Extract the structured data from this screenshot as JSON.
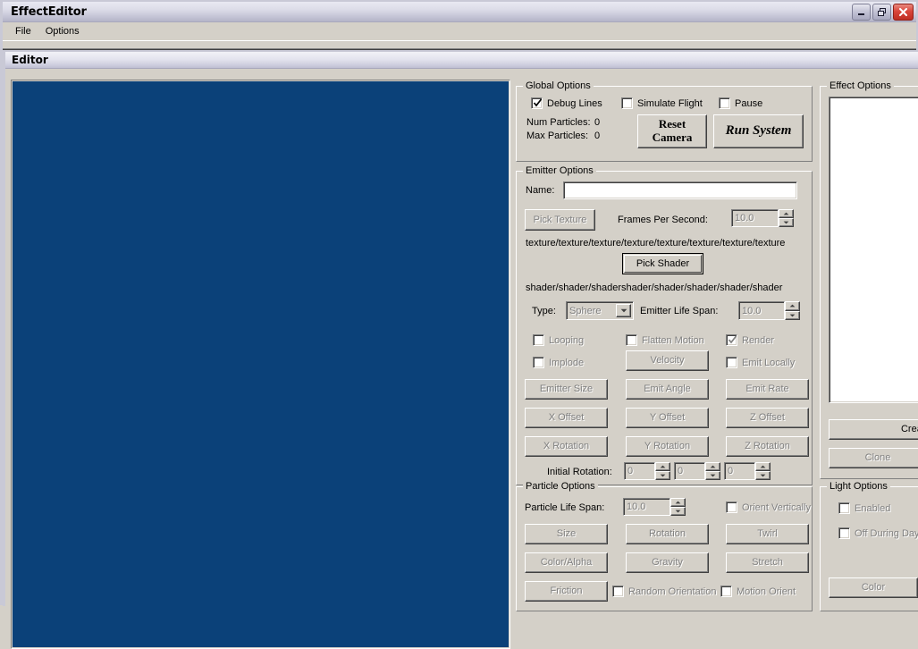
{
  "window": {
    "title": "EffectEditor",
    "buttons": {
      "minimize": "minimize-button",
      "maximize": "restore-button",
      "close": "close-button"
    }
  },
  "menubar": {
    "items": [
      {
        "label": "File"
      },
      {
        "label": "Options"
      }
    ]
  },
  "child_window": {
    "title": "Editor"
  },
  "viewport": {
    "background_color": "#0b4179"
  },
  "global_options": {
    "title": "Global Options",
    "checkboxes": [
      {
        "label": "Debug Lines",
        "checked": true,
        "enabled": true
      },
      {
        "label": "Simulate Flight",
        "checked": false,
        "enabled": true
      },
      {
        "label": "Pause",
        "checked": false,
        "enabled": true
      }
    ],
    "num_particles_label": "Num Particles:",
    "num_particles_value": "0",
    "max_particles_label": "Max Particles:",
    "max_particles_value": "0",
    "reset_camera_label": "Reset\nCamera",
    "reset_camera_line1": "Reset",
    "reset_camera_line2": "Camera",
    "run_system_label": "Run System"
  },
  "emitter_options": {
    "title": "Emitter Options",
    "name_label": "Name:",
    "name_value": "",
    "name_placeholder": "",
    "pick_texture_label": "Pick Texture",
    "frames_per_second_label": "Frames Per Second:",
    "frames_per_second_value": "10.0",
    "texture_path": "texture/texture/texture/texture/texture/texture/texture/texture",
    "pick_shader_label": "Pick Shader",
    "shader_path": "shader/shader/shadershader/shader/shader/shader/shader",
    "type_label": "Type:",
    "type_value": "Sphere",
    "emitter_life_span_label": "Emitter Life Span:",
    "emitter_life_span_value": "10.0",
    "checkboxes": [
      {
        "label": "Looping",
        "checked": false,
        "enabled": false
      },
      {
        "label": "Flatten Motion",
        "checked": false,
        "enabled": false
      },
      {
        "label": "Render",
        "checked": true,
        "enabled": false
      },
      {
        "label": "Implode",
        "checked": false,
        "enabled": false
      },
      {
        "label": "Emit Locally",
        "checked": false,
        "enabled": false
      }
    ],
    "buttons": [
      {
        "label": "Velocity",
        "enabled": false
      },
      {
        "label": "Emitter Size",
        "enabled": false
      },
      {
        "label": "Emit Angle",
        "enabled": false
      },
      {
        "label": "Emit Rate",
        "enabled": false
      },
      {
        "label": "X Offset",
        "enabled": false
      },
      {
        "label": "Y Offset",
        "enabled": false
      },
      {
        "label": "Z Offset",
        "enabled": false
      },
      {
        "label": "X Rotation",
        "enabled": false
      },
      {
        "label": "Y Rotation",
        "enabled": false
      },
      {
        "label": "Z Rotation",
        "enabled": false
      }
    ],
    "initial_rotation_label": "Initial Rotation:",
    "initial_rotation_values": [
      "0",
      "0",
      "0"
    ]
  },
  "particle_options": {
    "title": "Particle Options",
    "particle_life_span_label": "Particle Life Span:",
    "particle_life_span_value": "10.0",
    "orient_vertically_label": "Orient Vertically",
    "random_orientation_label": "Random Orientation",
    "motion_orient_label": "Motion Orient",
    "buttons": [
      {
        "label": "Size",
        "enabled": false
      },
      {
        "label": "Rotation",
        "enabled": false
      },
      {
        "label": "Twirl",
        "enabled": false
      },
      {
        "label": "Color/Alpha",
        "enabled": false
      },
      {
        "label": "Gravity",
        "enabled": false
      },
      {
        "label": "Stretch",
        "enabled": false
      },
      {
        "label": "Friction",
        "enabled": false
      }
    ]
  },
  "effect_options": {
    "title": "Effect Options",
    "list_items": [],
    "create_label": "Create",
    "clone_label": "Clone"
  },
  "light_options": {
    "title": "Light Options",
    "enabled_label": "Enabled",
    "off_during_day_label": "Off During Day",
    "color_label": "Color"
  }
}
